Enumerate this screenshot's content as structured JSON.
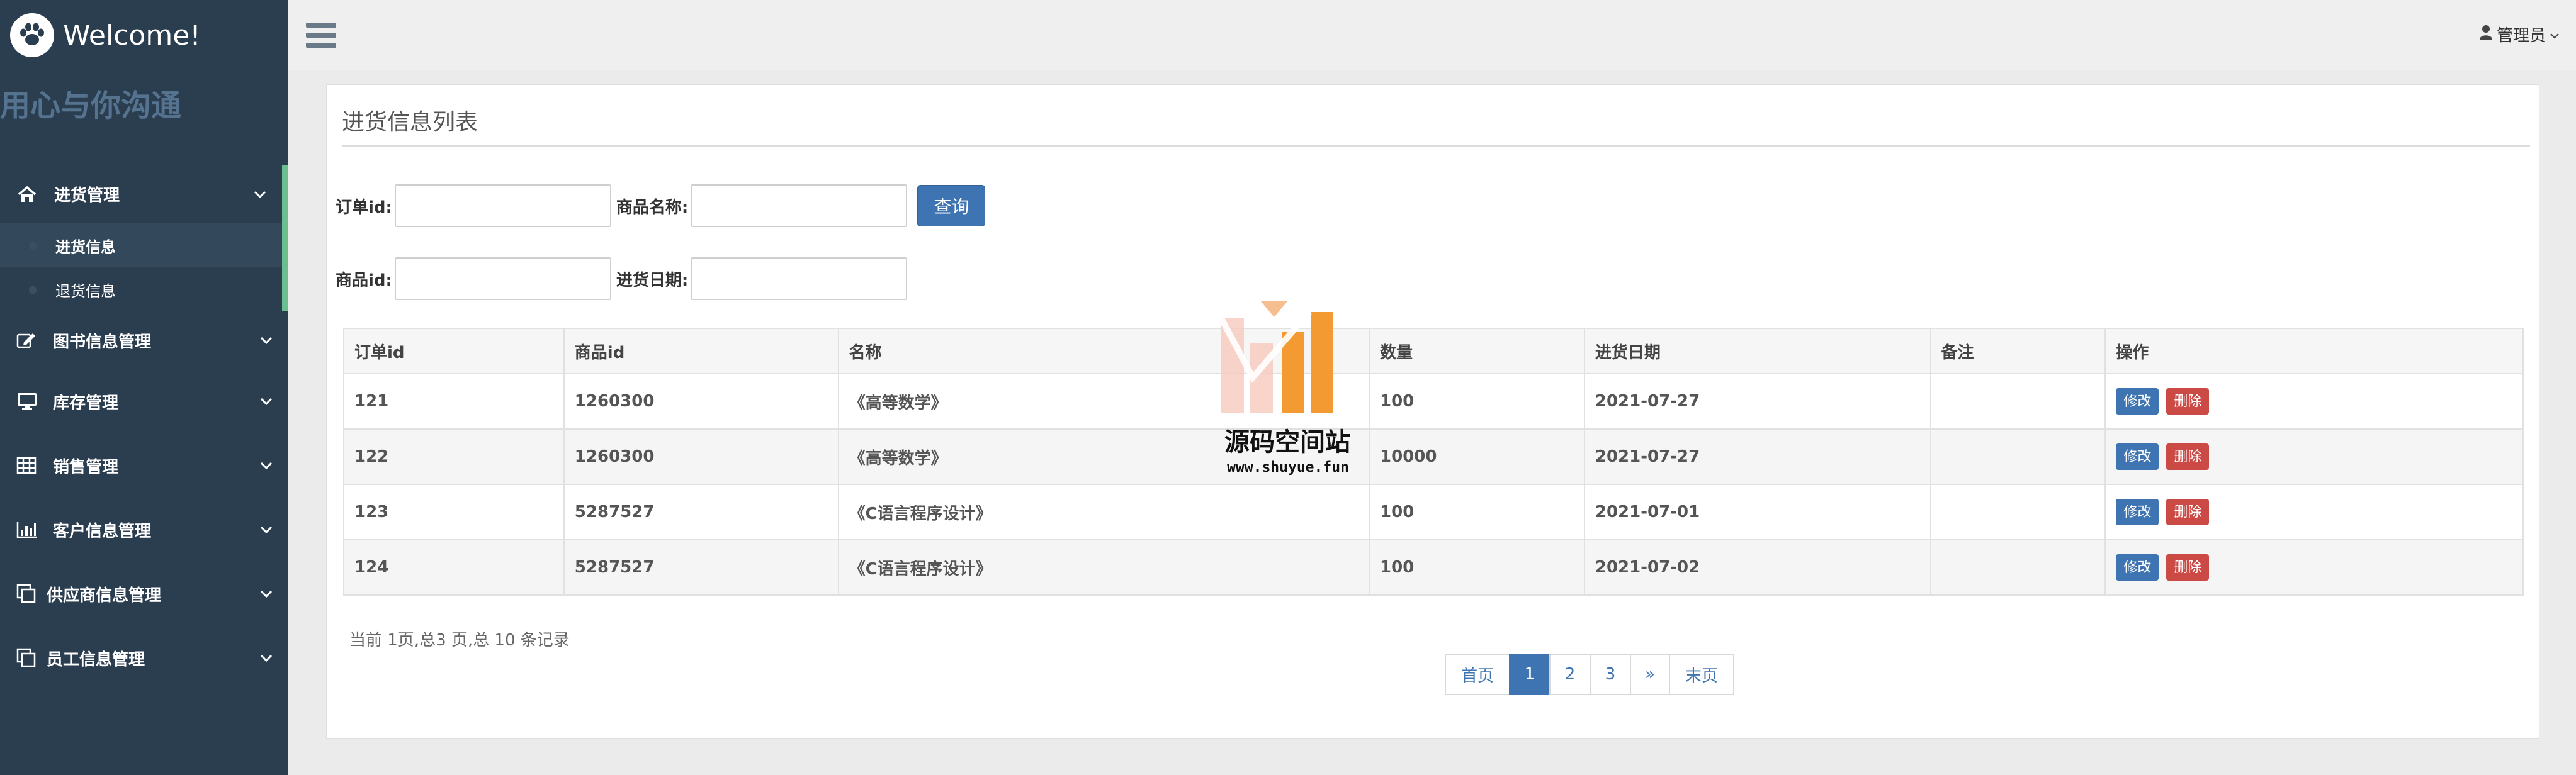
{
  "brand": {
    "title": "Welcome!",
    "slogan": "用心与你沟通"
  },
  "sidebar": {
    "groups": [
      {
        "label": "进货管理",
        "icon": "home-icon",
        "open": true,
        "items": [
          {
            "label": "进货信息",
            "active": true
          },
          {
            "label": "退货信息",
            "active": false
          }
        ]
      },
      {
        "label": "图书信息管理",
        "icon": "edit-icon"
      },
      {
        "label": "库存管理",
        "icon": "monitor-icon"
      },
      {
        "label": "销售管理",
        "icon": "table-icon"
      },
      {
        "label": "客户信息管理",
        "icon": "bar-chart-icon"
      },
      {
        "label": "供应商信息管理",
        "icon": "copy-icon"
      },
      {
        "label": "员工信息管理",
        "icon": "copy-icon"
      }
    ]
  },
  "topbar": {
    "user": "管理员"
  },
  "panel": {
    "title": "进货信息列表"
  },
  "search": {
    "order_id_label": "订单id:",
    "product_name_label": "商品名称:",
    "query_button": "查询",
    "product_id_label": "商品id:",
    "date_label": "进货日期:"
  },
  "table": {
    "columns": [
      "订单id",
      "商品id",
      "名称",
      "数量",
      "进货日期",
      "备注",
      "操作"
    ],
    "rows": [
      {
        "order_id": "121",
        "product_id": "1260300",
        "name": "《高等数学》",
        "qty": "100",
        "date": "2021-07-27",
        "note": ""
      },
      {
        "order_id": "122",
        "product_id": "1260300",
        "name": "《高等数学》",
        "qty": "10000",
        "date": "2021-07-27",
        "note": ""
      },
      {
        "order_id": "123",
        "product_id": "5287527",
        "name": "《C语言程序设计》",
        "qty": "100",
        "date": "2021-07-01",
        "note": ""
      },
      {
        "order_id": "124",
        "product_id": "5287527",
        "name": "《C语言程序设计》",
        "qty": "100",
        "date": "2021-07-02",
        "note": ""
      }
    ],
    "edit_label": "修改",
    "delete_label": "删除"
  },
  "pagination": {
    "info": "当前 1页,总3 页,总 10 条记录",
    "first": "首页",
    "pages": [
      "1",
      "2",
      "3"
    ],
    "current": "1",
    "next": "»",
    "last": "末页"
  },
  "watermark": {
    "name": "源码空间站",
    "url": "www.shuyue.fun"
  },
  "colors": {
    "sidebar": "#2b3e50",
    "primary": "#3e74b2",
    "danger": "#cb4a45",
    "active_bar": "#6bbf8e"
  }
}
